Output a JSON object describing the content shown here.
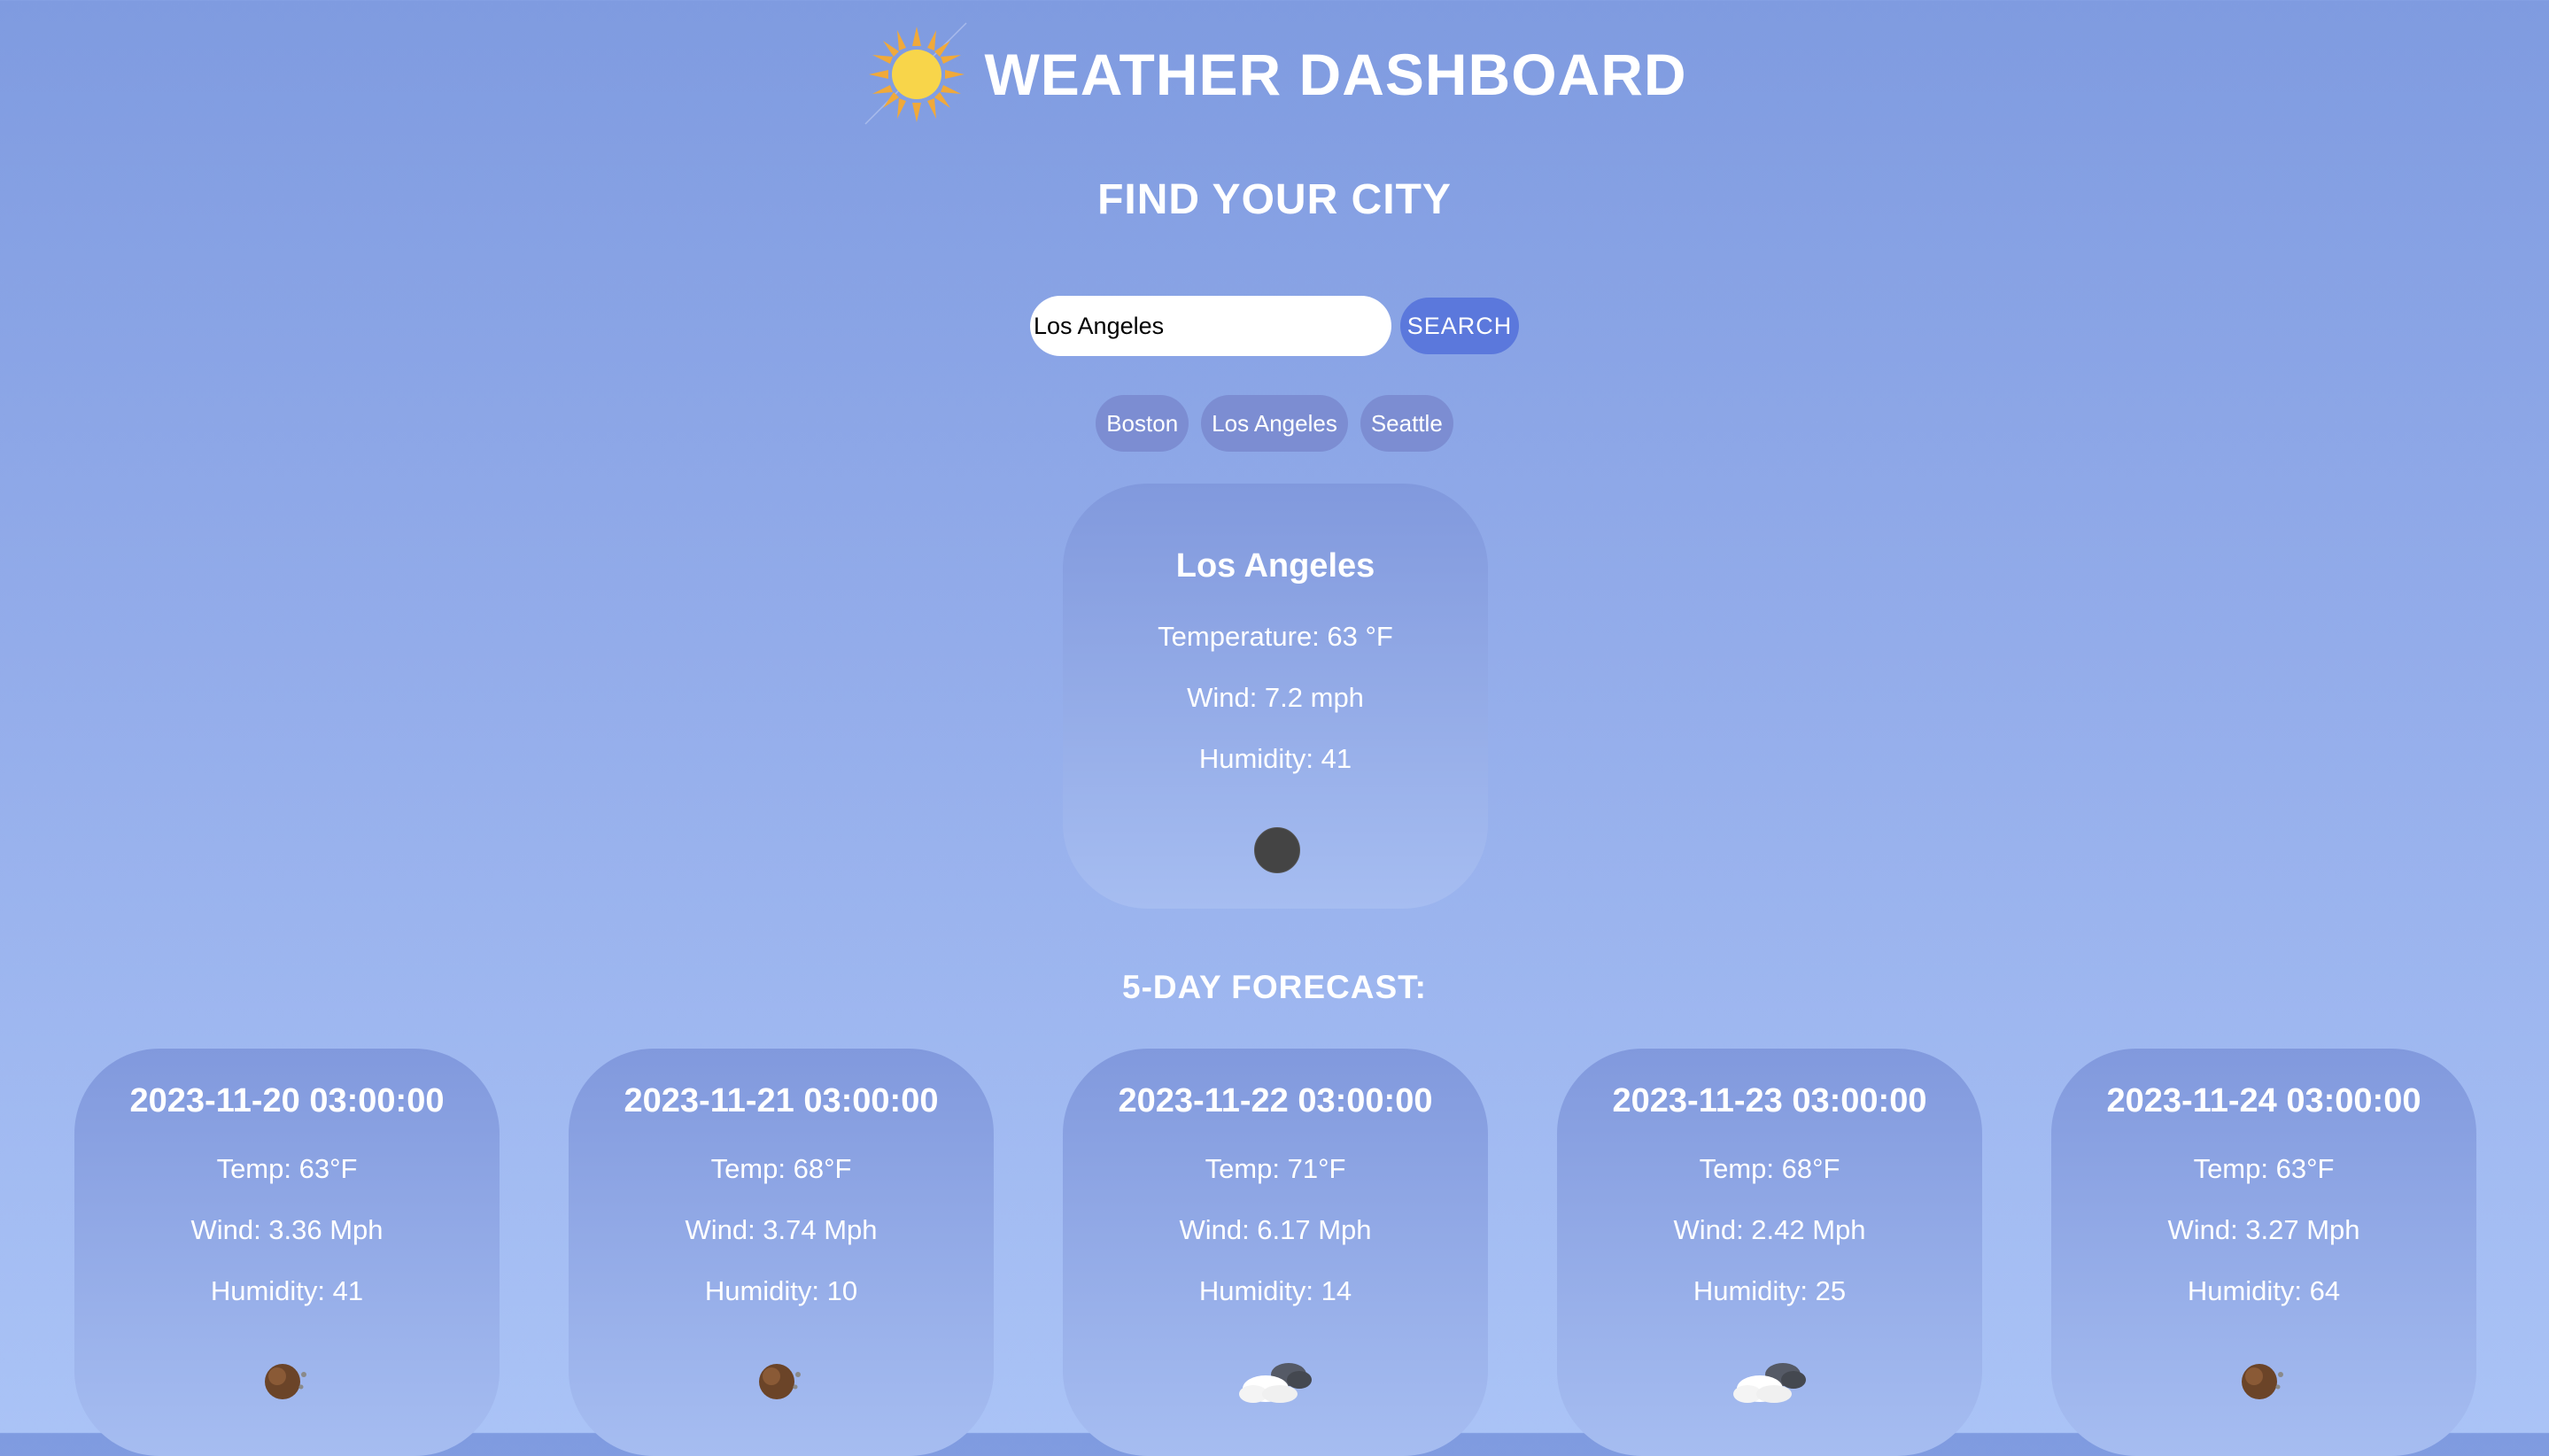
{
  "app": {
    "title": "WEATHER DASHBOARD",
    "logo_icon": "sun-icon"
  },
  "search": {
    "heading": "FIND YOUR CITY",
    "value": "Los Angeles",
    "button_label": "SEARCH"
  },
  "history": [
    {
      "label": "Boston"
    },
    {
      "label": "Los Angeles"
    },
    {
      "label": "Seattle"
    }
  ],
  "current": {
    "city": "Los Angeles",
    "temperature": "Temperature: 63 °F",
    "wind": "Wind: 7.2 mph",
    "humidity": "Humidity: 41",
    "icon": "night-clear-icon"
  },
  "forecast": {
    "heading": "5-DAY FORECAST:",
    "days": [
      {
        "date": "2023-11-20 03:00:00",
        "temp": "Temp: 63°F",
        "wind": "Wind: 3.36 Mph",
        "humidity": "Humidity: 41",
        "icon": "moon-icon"
      },
      {
        "date": "2023-11-21 03:00:00",
        "temp": "Temp: 68°F",
        "wind": "Wind: 3.74 Mph",
        "humidity": "Humidity: 10",
        "icon": "moon-icon"
      },
      {
        "date": "2023-11-22 03:00:00",
        "temp": "Temp: 71°F",
        "wind": "Wind: 6.17 Mph",
        "humidity": "Humidity: 14",
        "icon": "cloudy-icon"
      },
      {
        "date": "2023-11-23 03:00:00",
        "temp": "Temp: 68°F",
        "wind": "Wind: 2.42 Mph",
        "humidity": "Humidity: 25",
        "icon": "cloudy-icon"
      },
      {
        "date": "2023-11-24 03:00:00",
        "temp": "Temp: 63°F",
        "wind": "Wind: 3.27 Mph",
        "humidity": "Humidity: 64",
        "icon": "moon-icon"
      }
    ]
  }
}
